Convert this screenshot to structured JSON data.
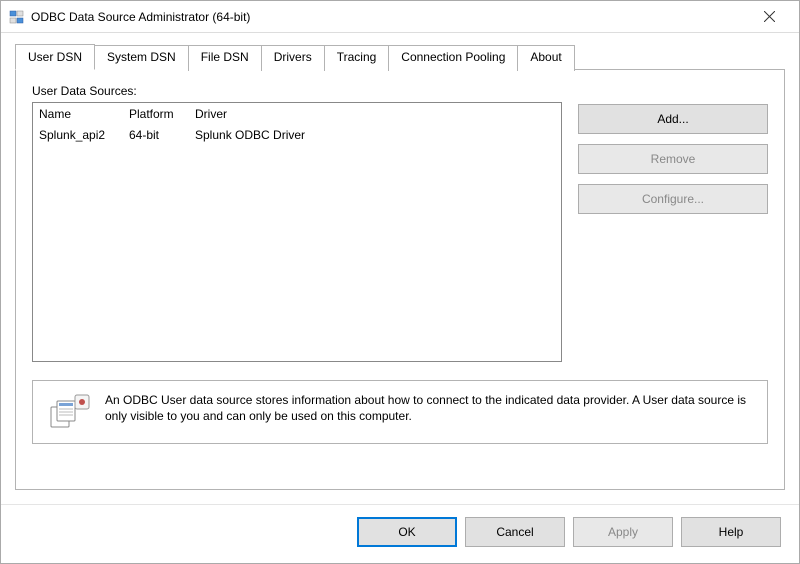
{
  "window": {
    "title": "ODBC Data Source Administrator (64-bit)"
  },
  "tabs": {
    "user_dsn": "User DSN",
    "system_dsn": "System DSN",
    "file_dsn": "File DSN",
    "drivers": "Drivers",
    "tracing": "Tracing",
    "connection_pooling": "Connection Pooling",
    "about": "About"
  },
  "panel": {
    "list_label": "User Data Sources:",
    "columns": {
      "name": "Name",
      "platform": "Platform",
      "driver": "Driver"
    },
    "rows": [
      {
        "name": "Splunk_api2",
        "platform": "64-bit",
        "driver": "Splunk ODBC Driver"
      }
    ],
    "buttons": {
      "add": "Add...",
      "remove": "Remove",
      "configure": "Configure..."
    },
    "info_text": "An ODBC User data source stores information about how to connect to the indicated data provider.   A User data source is only visible to you and can only be used on this computer."
  },
  "footer": {
    "ok": "OK",
    "cancel": "Cancel",
    "apply": "Apply",
    "help": "Help"
  }
}
